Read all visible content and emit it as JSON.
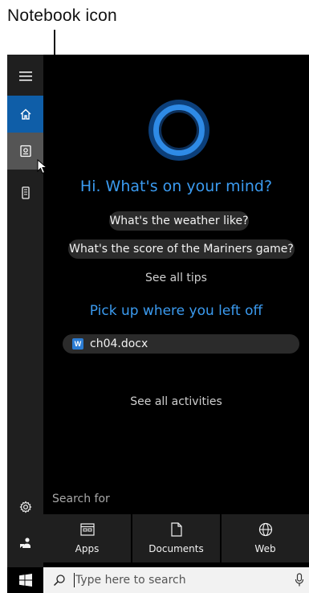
{
  "callout": {
    "label": "Notebook icon"
  },
  "rail": {
    "items": [
      {
        "icon": "hamburger-menu-icon"
      },
      {
        "icon": "home-icon",
        "state": "active",
        "color": "#0f5ea8"
      },
      {
        "icon": "notebook-icon",
        "state": "hover",
        "color": "#555555"
      },
      {
        "icon": "device-icon"
      }
    ],
    "bottom_items": [
      {
        "icon": "gear-icon"
      },
      {
        "icon": "feedback-icon"
      }
    ]
  },
  "cortana": {
    "ring_color": "#2e8ae6",
    "greeting": "Hi. What's on your mind?",
    "suggestions": [
      "What's the weather like?",
      "What's the score of the Mariners game?"
    ],
    "see_all_tips": "See all tips",
    "resume_heading": "Pick up where you left off",
    "recent_files": [
      {
        "name": "ch04.docx",
        "icon": "word-document-icon"
      }
    ],
    "see_all_activities": "See all activities"
  },
  "search_for": {
    "heading": "Search for",
    "tiles": [
      {
        "label": "Apps",
        "icon": "apps-icon"
      },
      {
        "label": "Documents",
        "icon": "document-icon"
      },
      {
        "label": "Web",
        "icon": "globe-icon"
      }
    ]
  },
  "taskbar": {
    "search_placeholder": "Type here to search",
    "start_icon": "windows-logo-icon",
    "mic_icon": "microphone-icon"
  },
  "colors": {
    "accent": "#3b9bf0",
    "panel_bg": "#000000",
    "rail_bg": "#1f1f1f"
  }
}
